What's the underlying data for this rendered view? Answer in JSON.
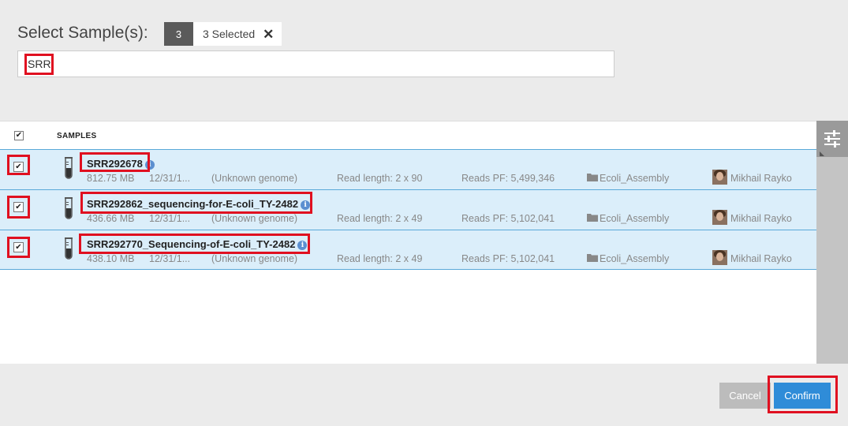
{
  "header": {
    "title": "Select Sample(s):",
    "selected_count": "3",
    "selected_label": "3 Selected",
    "clear_symbol": "✕"
  },
  "search": {
    "value": "SRR"
  },
  "table": {
    "header_label": "SAMPLES",
    "rows": [
      {
        "name": "SRR292678",
        "size": "812.75 MB",
        "date": "12/31/1...",
        "genome": "(Unknown genome)",
        "read_length": "Read length: 2 x 90",
        "reads_pf": "Reads PF: 5,499,346",
        "project": "Ecoli_Assembly",
        "owner": "Mikhail Rayko",
        "checked": true
      },
      {
        "name": "SRR292862_sequencing-for-E-coli_TY-2482",
        "size": "436.66 MB",
        "date": "12/31/1...",
        "genome": "(Unknown genome)",
        "read_length": "Read length: 2 x 49",
        "reads_pf": "Reads PF: 5,102,041",
        "project": "Ecoli_Assembly",
        "owner": "Mikhail Rayko",
        "checked": true
      },
      {
        "name": "SRR292770_Sequencing-of-E-coli_TY-2482",
        "size": "438.10 MB",
        "date": "12/31/1...",
        "genome": "(Unknown genome)",
        "read_length": "Read length: 2 x 49",
        "reads_pf": "Reads PF: 5,102,041",
        "project": "Ecoli_Assembly",
        "owner": "Mikhail Rayko",
        "checked": true
      }
    ]
  },
  "footer": {
    "cancel_label": "Cancel",
    "confirm_label": "Confirm"
  },
  "colors": {
    "highlight": "#e01020",
    "row_bg": "#dbeefa",
    "confirm": "#2f8cd8"
  }
}
